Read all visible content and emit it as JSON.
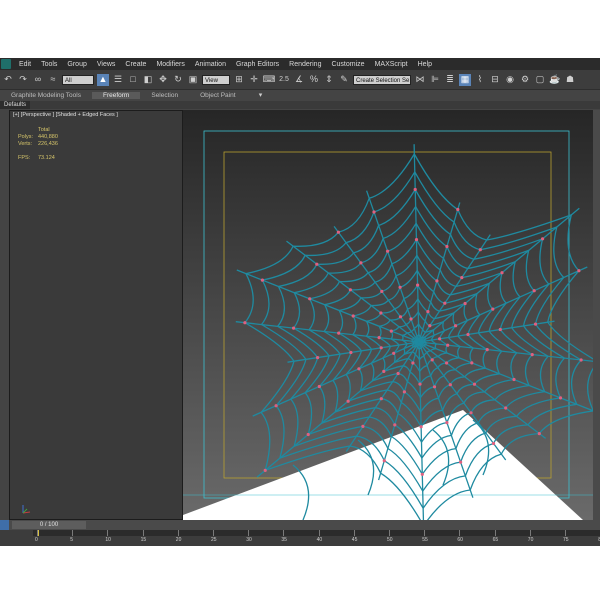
{
  "menu": {
    "items": [
      "Edit",
      "Tools",
      "Group",
      "Views",
      "Create",
      "Modifiers",
      "Animation",
      "Graph Editors",
      "Rendering",
      "Customize",
      "MAXScript",
      "Help"
    ]
  },
  "toolbar": {
    "selection_filter": "All",
    "reference_coord": "View",
    "snap_label": "2.5",
    "named_selection_placeholder": "Create Selection Se"
  },
  "ribbon": {
    "tabs": [
      "Graphite Modeling Tools",
      "Freeform",
      "Selection",
      "Object Paint"
    ]
  },
  "subtab": {
    "label": "Defaults"
  },
  "viewport": {
    "label": "[+] [Perspective ] [Shaded + Edged Faces ]",
    "stats": {
      "header": "Total",
      "polys_label": "Polys:",
      "polys_value": "440,880",
      "verts_label": "Verts:",
      "verts_value": "226,436",
      "fps_label": "FPS:",
      "fps_value": "73.124"
    }
  },
  "timeline": {
    "slider_label": "0 / 100",
    "ticks": [
      "0",
      "5",
      "10",
      "15",
      "20",
      "25",
      "30",
      "35",
      "40",
      "45",
      "50",
      "55",
      "60",
      "65",
      "70",
      "75",
      "80"
    ]
  },
  "colors": {
    "web": "#1f8aa0",
    "vertex": "#e06080",
    "frame_cyan": "#3cc0d0",
    "frame_yellow": "#b8a030"
  }
}
